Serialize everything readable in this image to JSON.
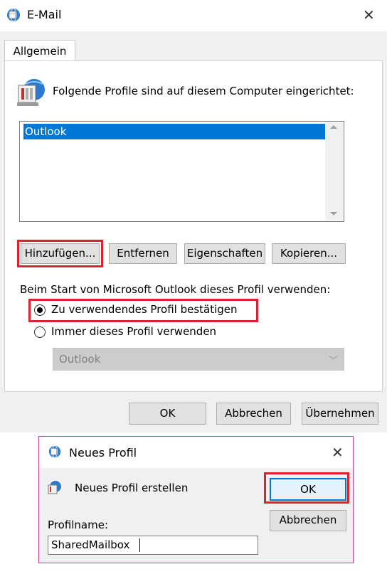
{
  "colors": {
    "accent": "#0078d7",
    "highlight_box": "#e0202e",
    "dialog_bg": "#f0f0f0"
  },
  "main_dialog": {
    "title": "E-Mail",
    "title_icon": "mail-globe-icon",
    "close_icon": "close-icon",
    "tab_label": "Allgemein",
    "prompt": "Folgende Profile sind auf diesem Computer eingerichtet:",
    "profiles": [
      "Outlook"
    ],
    "selected_profile": "Outlook",
    "buttons": {
      "add": "Hinzufügen...",
      "remove": "Entfernen",
      "properties": "Eigenschaften",
      "copy": "Kopieren..."
    },
    "startup_label": "Beim Start von Microsoft Outlook dieses Profil verwenden:",
    "radio_confirm": "Zu verwendendes Profil bestätigen",
    "radio_always": "Immer dieses Profil verwenden",
    "radio_selected": "confirm",
    "profile_combo_value": "Outlook",
    "ok": "OK",
    "cancel": "Abbrechen",
    "apply": "Übernehmen"
  },
  "new_profile_dialog": {
    "title": "Neues Profil",
    "title_icon": "mail-globe-icon",
    "close_icon": "close-icon",
    "heading": "Neues Profil erstellen",
    "ok": "OK",
    "cancel": "Abbrechen",
    "profile_name_label": "Profilname:",
    "profile_name_value": "SharedMailbox"
  }
}
